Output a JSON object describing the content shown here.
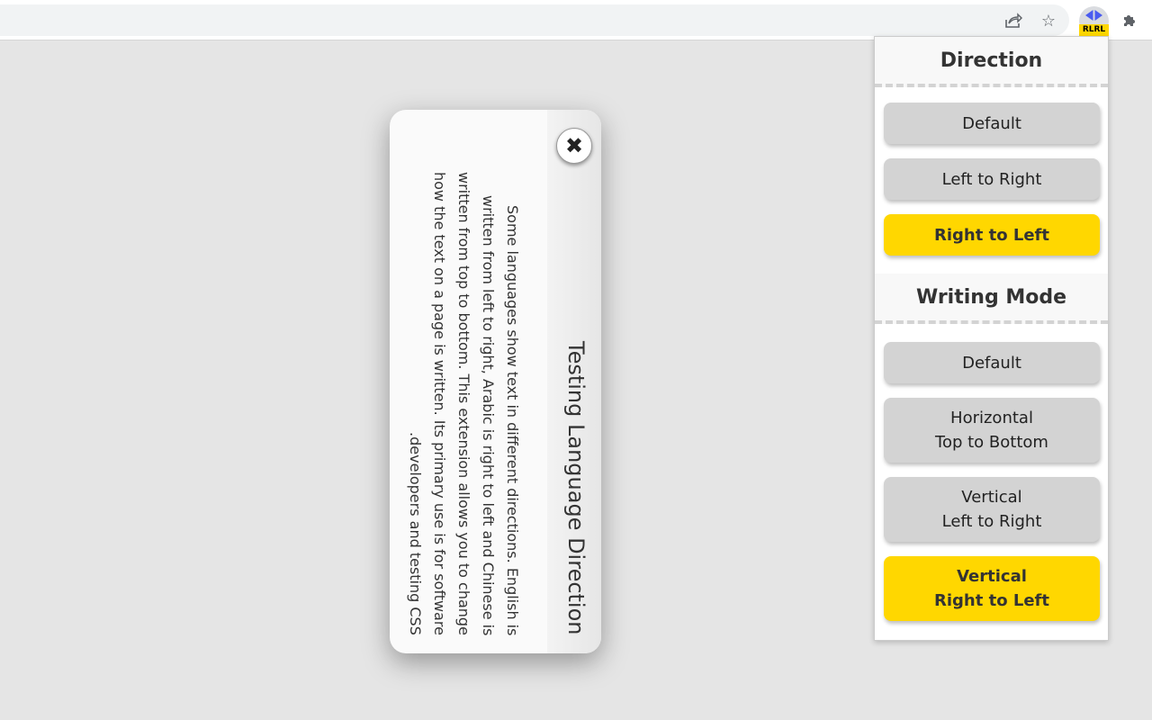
{
  "toolbar": {
    "share_icon": "share-icon",
    "bookmark_icon": "star-icon",
    "extension_badge": "RLRL",
    "puzzle_icon": "puzzle-icon"
  },
  "dialog": {
    "title": "Testing Language Direction",
    "body": "Some languages show text in different directions. English is written from left to right, Arabic is right to left and Chinese is written from top to bottom. This extension allows you to change how the text on a page is written. Its primary use is for software developers and testing CSS.",
    "close_icon": "close-icon"
  },
  "popup": {
    "direction": {
      "title": "Direction",
      "buttons": [
        {
          "label": "Default",
          "selected": false
        },
        {
          "label": "Left to Right",
          "selected": false
        },
        {
          "label": "Right to Left",
          "selected": true
        }
      ]
    },
    "writing_mode": {
      "title": "Writing Mode",
      "buttons": [
        {
          "label": "Default",
          "selected": false
        },
        {
          "label": "Horizontal\nTop to Bottom",
          "selected": false
        },
        {
          "label": "Vertical\nLeft to Right",
          "selected": false
        },
        {
          "label": "Vertical\nRight to Left",
          "selected": true
        }
      ]
    }
  },
  "colors": {
    "selected": "#ffd700",
    "button": "#d3d3d3",
    "ext_arrows": "#4a5cf0"
  }
}
